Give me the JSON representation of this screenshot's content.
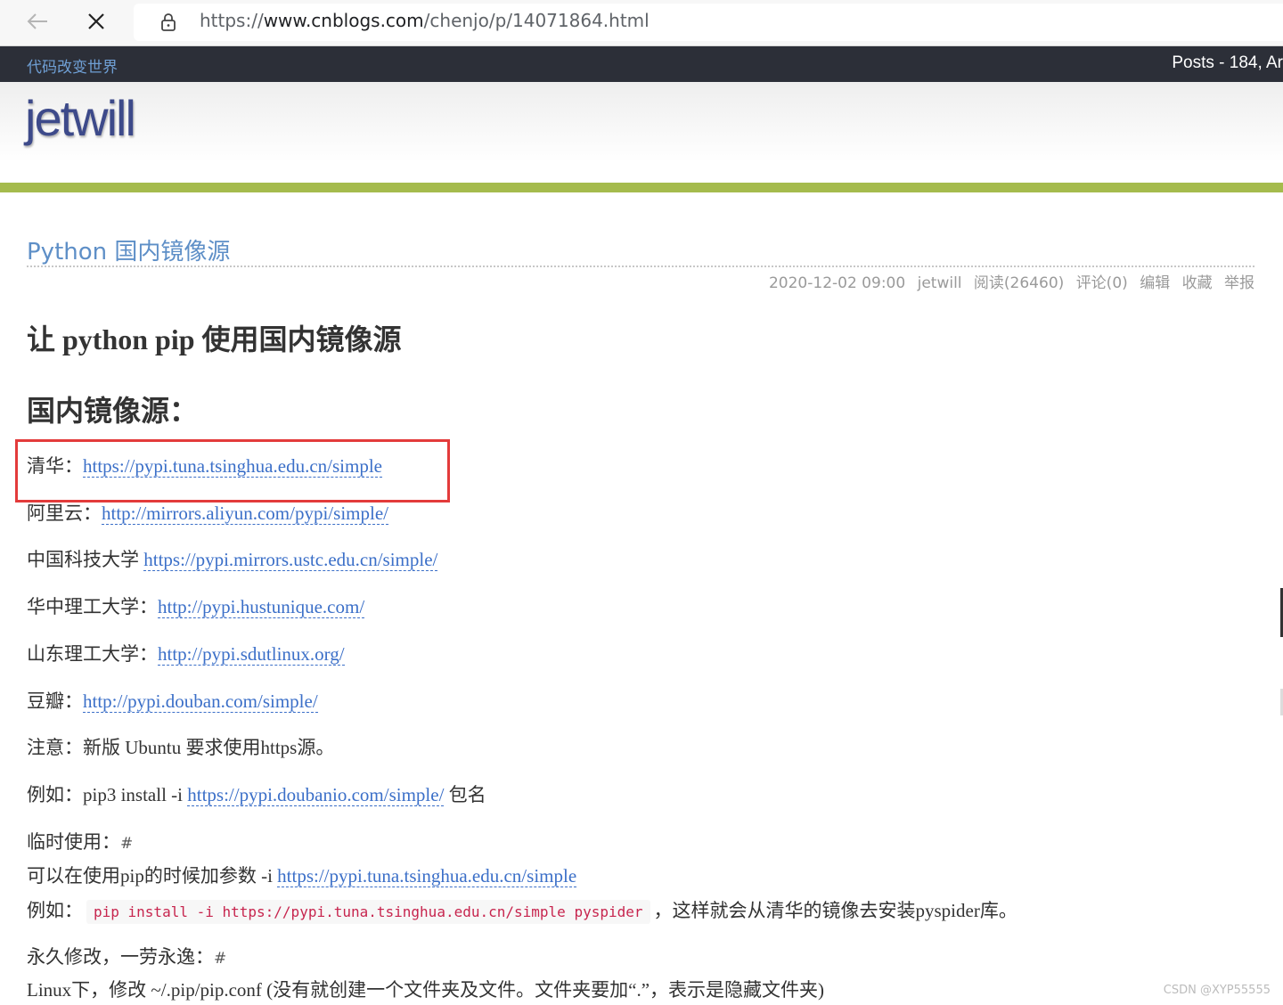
{
  "browser": {
    "url_scheme": "https://",
    "url_domain": "www.cnblogs.com",
    "url_path": "/chenjo/p/14071864.html"
  },
  "blog": {
    "site_name": "代码改变世界",
    "posts_stat": "Posts - 184, Ar",
    "title": "jetwill"
  },
  "post": {
    "title": "Python 国内镜像源",
    "meta": {
      "date": "2020-12-02 09:00",
      "author": "jetwill",
      "reads": "阅读(26460)",
      "comments": "评论(0)",
      "edit": "编辑",
      "favorite": "收藏",
      "report": "举报"
    },
    "heading1": "让 python pip 使用国内镜像源",
    "heading2": "国内镜像源：",
    "mirrors": [
      {
        "label": "清华：",
        "url": "https://pypi.tuna.tsinghua.edu.cn/simple"
      },
      {
        "label": "阿里云：",
        "url": "http://mirrors.aliyun.com/pypi/simple/"
      },
      {
        "label": "中国科技大学 ",
        "url": "https://pypi.mirrors.ustc.edu.cn/simple/"
      },
      {
        "label": "华中理工大学：",
        "url": "http://pypi.hustunique.com/"
      },
      {
        "label": "山东理工大学：",
        "url": "http://pypi.sdutlinux.org/"
      },
      {
        "label": "豆瓣：",
        "url": "http://pypi.douban.com/simple/"
      }
    ],
    "note": "注意：新版 Ubuntu 要求使用https源。",
    "example": {
      "prefix": "例如：pip3 install -i ",
      "url": "https://pypi.doubanio.com/simple/",
      "suffix": " 包名"
    },
    "temp_use": {
      "heading": "临时使用：",
      "anchor": "#",
      "text_prefix": "可以在使用pip的时候加参数 -i ",
      "url": "https://pypi.tuna.tsinghua.edu.cn/simple",
      "example_prefix": "例如：",
      "code": "pip install -i https://pypi.tuna.tsinghua.edu.cn/simple pyspider",
      "example_suffix": "，这样就会从清华的镜像去安装pyspider库。"
    },
    "permanent": {
      "heading": "永久修改，一劳永逸：",
      "anchor": "#",
      "text": "Linux下，修改 ~/.pip/pip.conf (没有就创建一个文件夹及文件。文件夹要加“.”，表示是隐藏文件夹)"
    }
  },
  "watermark": "CSDN @XYP55555",
  "colors": {
    "top_strip": "#2c2f38",
    "accent_green": "#a5bb4d",
    "link": "#3b6fc8",
    "title_blue": "#3d4a8a",
    "highlight_red": "#e33b3b"
  }
}
